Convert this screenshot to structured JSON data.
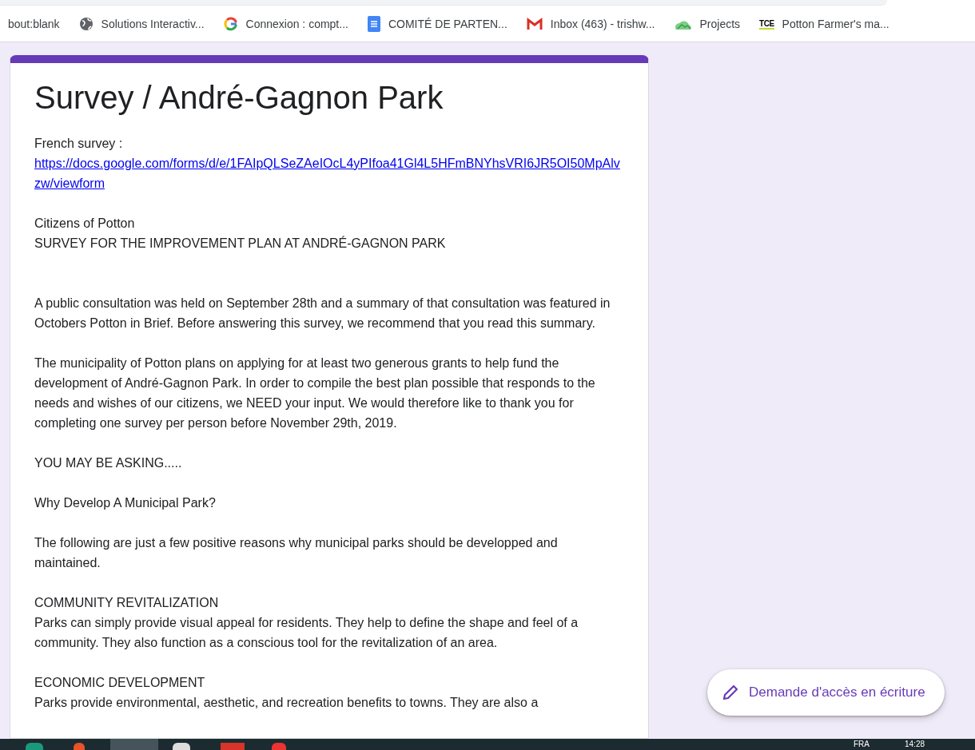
{
  "bookmarks": [
    {
      "kind": "plain",
      "label": "bout:blank"
    },
    {
      "kind": "globe",
      "label": "Solutions Interactiv..."
    },
    {
      "kind": "google",
      "label": "Connexion : compt..."
    },
    {
      "kind": "docs",
      "label": "COMITÉ DE PARTEN..."
    },
    {
      "kind": "mail",
      "label": "Inbox (463) - trishw..."
    },
    {
      "kind": "cloud",
      "label": "Projects"
    },
    {
      "kind": "badge",
      "badge": "TCE",
      "label": "Potton Farmer's ma..."
    }
  ],
  "form": {
    "title": "Survey / André-Gagnon Park",
    "blocks": [
      {
        "lines": [
          {
            "kind": "text",
            "text": "French survey :"
          },
          {
            "kind": "link",
            "text": "https://docs.google.com/forms/d/e/1FAIpQLSeZAeIOcL4yPIfoa41Gl4L5HFmBNYhsVRI6JR5OI50MpAlvzw/viewform"
          }
        ]
      },
      {
        "lines": [
          {
            "kind": "text",
            "text": "Citizens of Potton"
          },
          {
            "kind": "text",
            "text": "SURVEY FOR THE IMPROVEMENT PLAN AT ANDRÉ-GAGNON PARK"
          }
        ]
      },
      {
        "lines": [
          {
            "kind": "text",
            "text": "A public consultation was held on September 28th and a summary of that consultation was featured in Octobers Potton in Brief. Before answering this survey, we recommend that you read this summary."
          }
        ]
      },
      {
        "lines": [
          {
            "kind": "text",
            "text": "The municipality of Potton plans on applying for at least two generous grants to help fund the development of  André-Gagnon Park.  In order to compile the best plan possible that responds to the needs and wishes of our citizens, we NEED your input. We would therefore like to thank you for completing one survey per person before November 29th, 2019."
          }
        ]
      },
      {
        "lines": [
          {
            "kind": "text",
            "text": "YOU MAY BE ASKING....."
          }
        ]
      },
      {
        "lines": [
          {
            "kind": "text",
            "text": "Why Develop A Municipal Park?"
          }
        ]
      },
      {
        "lines": [
          {
            "kind": "text",
            "text": "The following are just a few positive reasons why municipal parks should be developped and maintained."
          }
        ]
      },
      {
        "lines": [
          {
            "kind": "text",
            "text": "COMMUNITY REVITALIZATION"
          },
          {
            "kind": "text",
            "text": "Parks can simply provide visual appeal for residents.  They help to define the shape and feel of a community. They also function as a conscious tool for the revitalization of an area."
          }
        ]
      },
      {
        "lines": [
          {
            "kind": "text",
            "text": "ECONOMIC DEVELOPMENT"
          },
          {
            "kind": "text",
            "text": "Parks provide environmental, aesthetic, and recreation benefits to towns. They are also a"
          }
        ]
      }
    ]
  },
  "request_button": {
    "label": "Demande d'accès en écriture"
  },
  "taskbar": {
    "language": "FRA",
    "time": "14:28"
  }
}
